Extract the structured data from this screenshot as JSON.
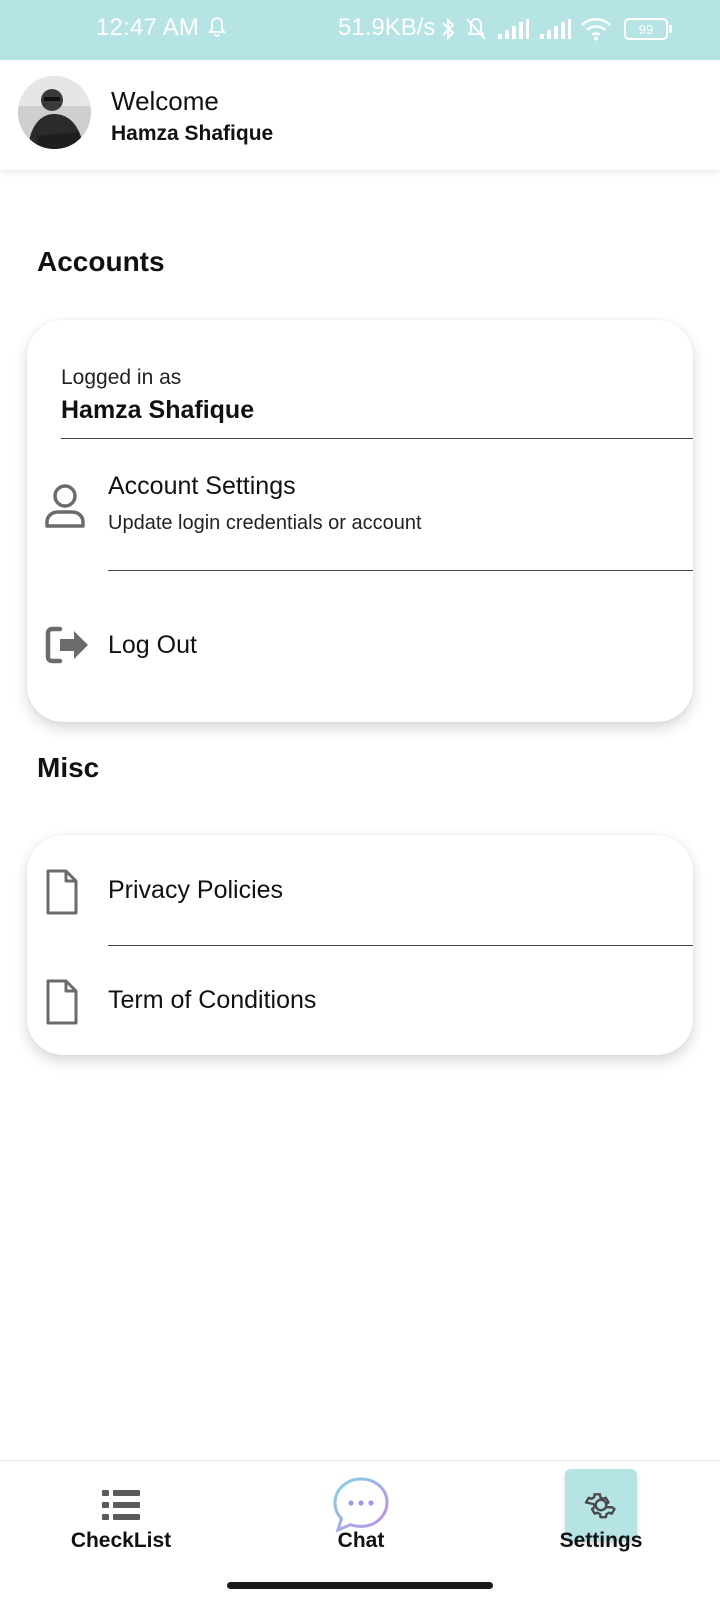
{
  "status_bar": {
    "time": "12:47 AM",
    "network_speed": "51.9KB/s",
    "battery": "99",
    "icons": [
      "bell-icon",
      "bluetooth-icon",
      "muted-bell-icon",
      "signal-icon",
      "signal-icon",
      "wifi-icon",
      "battery-icon"
    ]
  },
  "header": {
    "welcome": "Welcome",
    "user_name": "Hamza Shafique"
  },
  "accounts": {
    "section_title": "Accounts",
    "logged_in_label": "Logged in as",
    "logged_in_name": "Hamza Shafique",
    "account_settings_title": "Account Settings",
    "account_settings_subtitle": "Update login credentials or account",
    "logout_label": "Log Out"
  },
  "misc": {
    "section_title": "Misc",
    "privacy_label": "Privacy Policies",
    "terms_label": "Term of Conditions"
  },
  "bottom_nav": {
    "items": [
      {
        "label": "CheckList",
        "icon": "list-icon",
        "active": false
      },
      {
        "label": "Chat",
        "icon": "chat-bubble-icon",
        "active": false
      },
      {
        "label": "Settings",
        "icon": "gear-icon",
        "active": true
      }
    ]
  },
  "colors": {
    "status_bar_bg": "#b6e3e4",
    "active_tab_bg": "#b6e3e4",
    "icon_gray": "#6b6b6b"
  }
}
